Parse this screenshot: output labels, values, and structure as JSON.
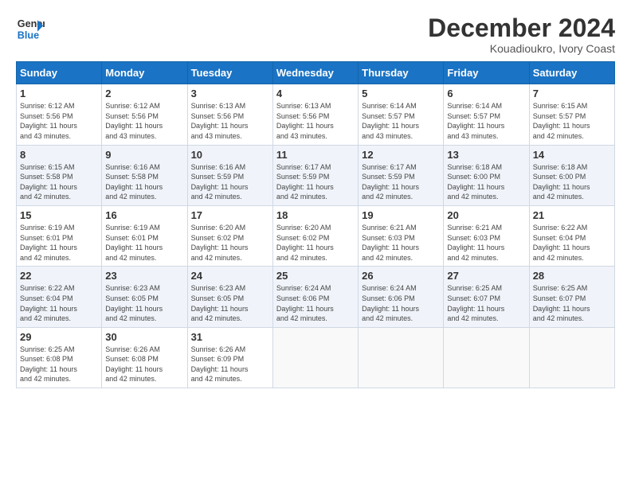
{
  "logo": {
    "line1": "General",
    "line2": "Blue"
  },
  "title": "December 2024",
  "subtitle": "Kouadioukro, Ivory Coast",
  "days_of_week": [
    "Sunday",
    "Monday",
    "Tuesday",
    "Wednesday",
    "Thursday",
    "Friday",
    "Saturday"
  ],
  "weeks": [
    [
      {
        "day": "1",
        "detail": "Sunrise: 6:12 AM\nSunset: 5:56 PM\nDaylight: 11 hours\nand 43 minutes."
      },
      {
        "day": "2",
        "detail": "Sunrise: 6:12 AM\nSunset: 5:56 PM\nDaylight: 11 hours\nand 43 minutes."
      },
      {
        "day": "3",
        "detail": "Sunrise: 6:13 AM\nSunset: 5:56 PM\nDaylight: 11 hours\nand 43 minutes."
      },
      {
        "day": "4",
        "detail": "Sunrise: 6:13 AM\nSunset: 5:56 PM\nDaylight: 11 hours\nand 43 minutes."
      },
      {
        "day": "5",
        "detail": "Sunrise: 6:14 AM\nSunset: 5:57 PM\nDaylight: 11 hours\nand 43 minutes."
      },
      {
        "day": "6",
        "detail": "Sunrise: 6:14 AM\nSunset: 5:57 PM\nDaylight: 11 hours\nand 43 minutes."
      },
      {
        "day": "7",
        "detail": "Sunrise: 6:15 AM\nSunset: 5:57 PM\nDaylight: 11 hours\nand 42 minutes."
      }
    ],
    [
      {
        "day": "8",
        "detail": "Sunrise: 6:15 AM\nSunset: 5:58 PM\nDaylight: 11 hours\nand 42 minutes."
      },
      {
        "day": "9",
        "detail": "Sunrise: 6:16 AM\nSunset: 5:58 PM\nDaylight: 11 hours\nand 42 minutes."
      },
      {
        "day": "10",
        "detail": "Sunrise: 6:16 AM\nSunset: 5:59 PM\nDaylight: 11 hours\nand 42 minutes."
      },
      {
        "day": "11",
        "detail": "Sunrise: 6:17 AM\nSunset: 5:59 PM\nDaylight: 11 hours\nand 42 minutes."
      },
      {
        "day": "12",
        "detail": "Sunrise: 6:17 AM\nSunset: 5:59 PM\nDaylight: 11 hours\nand 42 minutes."
      },
      {
        "day": "13",
        "detail": "Sunrise: 6:18 AM\nSunset: 6:00 PM\nDaylight: 11 hours\nand 42 minutes."
      },
      {
        "day": "14",
        "detail": "Sunrise: 6:18 AM\nSunset: 6:00 PM\nDaylight: 11 hours\nand 42 minutes."
      }
    ],
    [
      {
        "day": "15",
        "detail": "Sunrise: 6:19 AM\nSunset: 6:01 PM\nDaylight: 11 hours\nand 42 minutes."
      },
      {
        "day": "16",
        "detail": "Sunrise: 6:19 AM\nSunset: 6:01 PM\nDaylight: 11 hours\nand 42 minutes."
      },
      {
        "day": "17",
        "detail": "Sunrise: 6:20 AM\nSunset: 6:02 PM\nDaylight: 11 hours\nand 42 minutes."
      },
      {
        "day": "18",
        "detail": "Sunrise: 6:20 AM\nSunset: 6:02 PM\nDaylight: 11 hours\nand 42 minutes."
      },
      {
        "day": "19",
        "detail": "Sunrise: 6:21 AM\nSunset: 6:03 PM\nDaylight: 11 hours\nand 42 minutes."
      },
      {
        "day": "20",
        "detail": "Sunrise: 6:21 AM\nSunset: 6:03 PM\nDaylight: 11 hours\nand 42 minutes."
      },
      {
        "day": "21",
        "detail": "Sunrise: 6:22 AM\nSunset: 6:04 PM\nDaylight: 11 hours\nand 42 minutes."
      }
    ],
    [
      {
        "day": "22",
        "detail": "Sunrise: 6:22 AM\nSunset: 6:04 PM\nDaylight: 11 hours\nand 42 minutes."
      },
      {
        "day": "23",
        "detail": "Sunrise: 6:23 AM\nSunset: 6:05 PM\nDaylight: 11 hours\nand 42 minutes."
      },
      {
        "day": "24",
        "detail": "Sunrise: 6:23 AM\nSunset: 6:05 PM\nDaylight: 11 hours\nand 42 minutes."
      },
      {
        "day": "25",
        "detail": "Sunrise: 6:24 AM\nSunset: 6:06 PM\nDaylight: 11 hours\nand 42 minutes."
      },
      {
        "day": "26",
        "detail": "Sunrise: 6:24 AM\nSunset: 6:06 PM\nDaylight: 11 hours\nand 42 minutes."
      },
      {
        "day": "27",
        "detail": "Sunrise: 6:25 AM\nSunset: 6:07 PM\nDaylight: 11 hours\nand 42 minutes."
      },
      {
        "day": "28",
        "detail": "Sunrise: 6:25 AM\nSunset: 6:07 PM\nDaylight: 11 hours\nand 42 minutes."
      }
    ],
    [
      {
        "day": "29",
        "detail": "Sunrise: 6:25 AM\nSunset: 6:08 PM\nDaylight: 11 hours\nand 42 minutes."
      },
      {
        "day": "30",
        "detail": "Sunrise: 6:26 AM\nSunset: 6:08 PM\nDaylight: 11 hours\nand 42 minutes."
      },
      {
        "day": "31",
        "detail": "Sunrise: 6:26 AM\nSunset: 6:09 PM\nDaylight: 11 hours\nand 42 minutes."
      },
      {
        "day": "",
        "detail": ""
      },
      {
        "day": "",
        "detail": ""
      },
      {
        "day": "",
        "detail": ""
      },
      {
        "day": "",
        "detail": ""
      }
    ]
  ]
}
